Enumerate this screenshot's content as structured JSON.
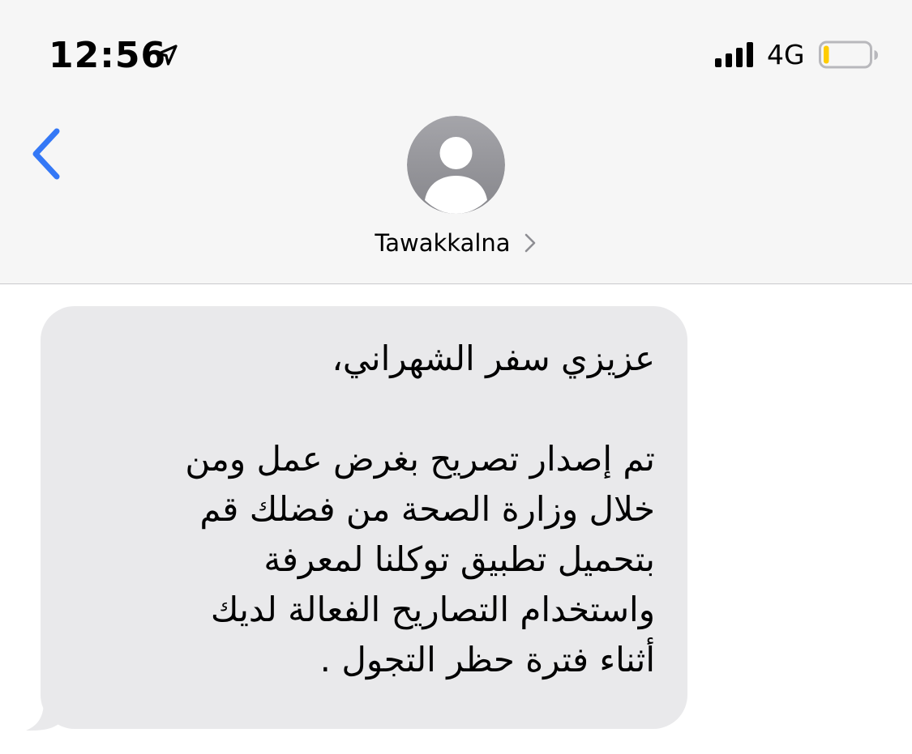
{
  "status_bar": {
    "time": "12:56",
    "network": "4G",
    "icons": [
      "location-arrow-icon",
      "signal-bars-icon",
      "battery-low-icon"
    ]
  },
  "header": {
    "back_icon": "chevron-left-icon",
    "avatar_icon": "person-silhouette-icon",
    "contact_name": "Tawakkalna",
    "contact_chevron_icon": "chevron-right-icon"
  },
  "conversation": {
    "messages": [
      {
        "direction": "incoming",
        "greeting": "عزيزي سفر الشهراني،",
        "lines": [
          "تم إصدار تصريح بغرض عمل ومن",
          "خلال وزارة الصحة من فضلك قم",
          "بتحميل تطبيق توكلنا لمعرفة",
          "واستخدام التصاريح الفعالة لديك",
          "أثناء فترة حظر التجول ."
        ]
      }
    ]
  },
  "colors": {
    "header_background": "#f6f6f6",
    "accent_blue": "#3478f6",
    "avatar_gray": "#8e8e93",
    "incoming_bubble": "#e9e9eb",
    "battery_level": "#ffcc00"
  },
  "battery": {
    "level_fraction": 0.12
  }
}
